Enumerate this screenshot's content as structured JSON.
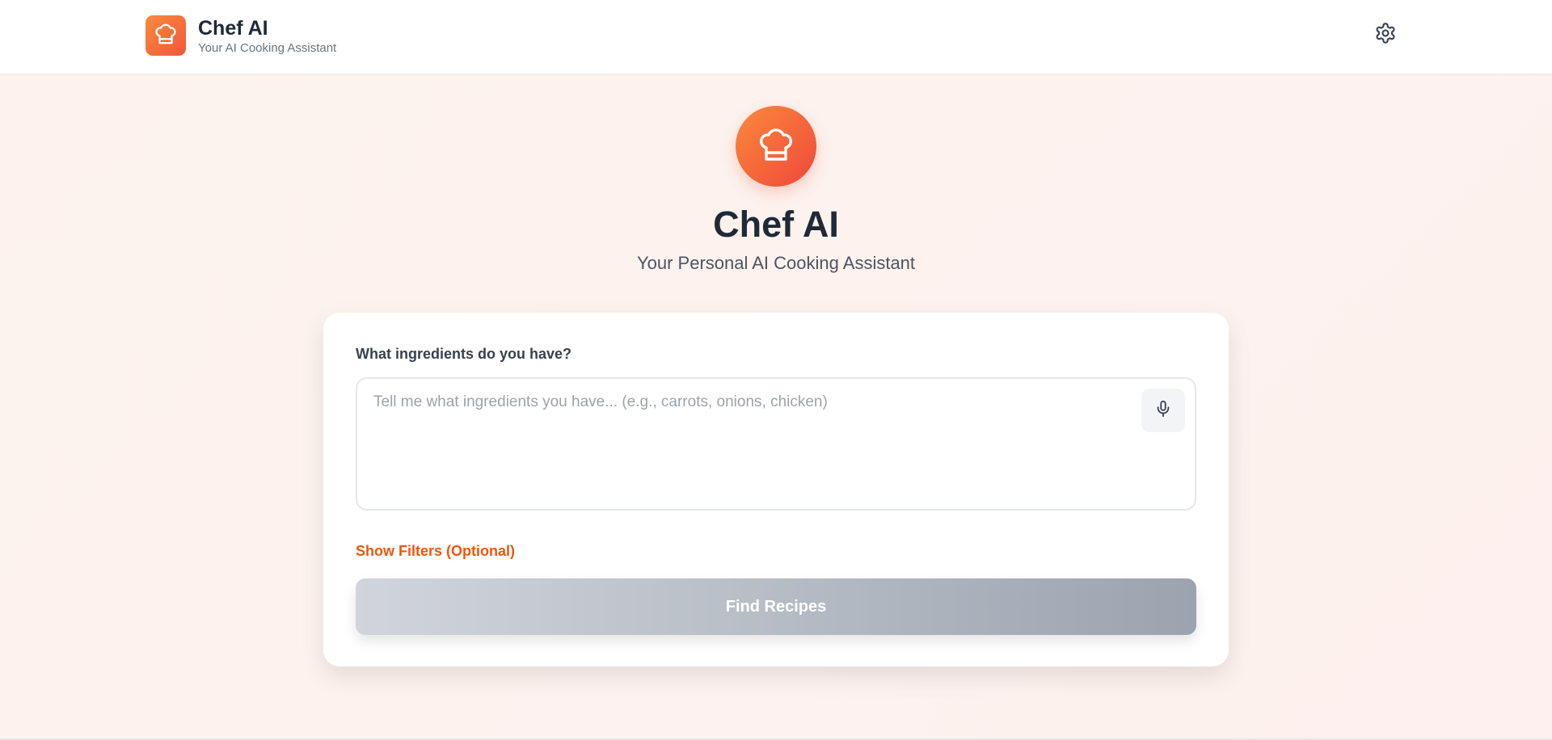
{
  "header": {
    "title": "Chef AI",
    "subtitle": "Your AI Cooking Assistant",
    "logo_icon": "chef-hat-icon",
    "settings_icon": "gear-icon"
  },
  "hero": {
    "title": "Chef AI",
    "subtitle": "Your Personal AI Cooking Assistant",
    "logo_icon": "chef-hat-icon"
  },
  "form": {
    "label": "What ingredients do you have?",
    "input_value": "",
    "input_placeholder": "Tell me what ingredients you have... (e.g., carrots, onions, chicken)",
    "mic_icon": "microphone-icon",
    "filters_label": "Show Filters (Optional)",
    "submit_label": "Find Recipes",
    "submit_disabled": true
  },
  "colors": {
    "accent": "#ea580c",
    "brand_gradient_start": "#fb8a3c",
    "brand_gradient_end": "#f0573a",
    "disabled_button_start": "#d1d5db",
    "disabled_button_end": "#9ca3af"
  }
}
